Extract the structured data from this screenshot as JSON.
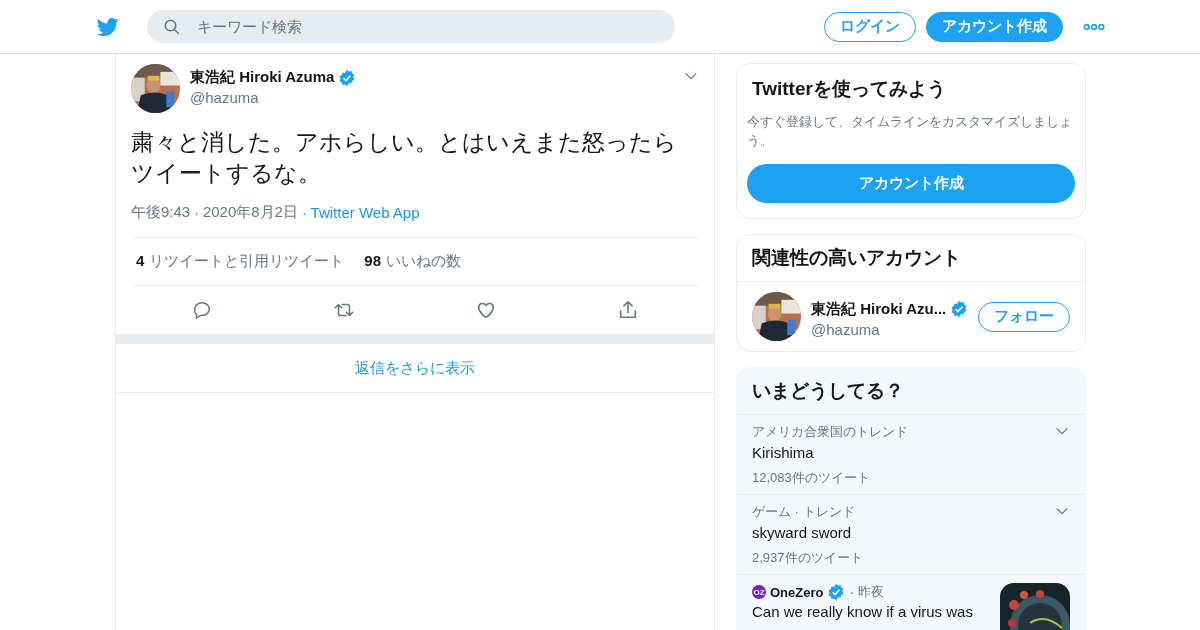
{
  "header": {
    "search": {
      "placeholder": "キーワード検索"
    },
    "login": "ログイン",
    "signup": "アカウント作成"
  },
  "tweet": {
    "name": "東浩紀 Hiroki Azuma",
    "verified": true,
    "handle": "@hazuma",
    "text": "粛々と消した。アホらしい。とはいえまた怒ったらツイートするな。",
    "meta": [
      {
        "kind": "time",
        "text": "午後9:43"
      },
      {
        "kind": "separator",
        "text": "·"
      },
      {
        "kind": "date",
        "text": "2020年8月2日"
      },
      {
        "kind": "separator",
        "text": "·"
      },
      {
        "kind": "source",
        "text": "Twitter Web App"
      }
    ],
    "stats": [
      {
        "count": "4",
        "label": "リツイートと引用リツイート"
      },
      {
        "count": "98",
        "label": "いいねの数"
      }
    ],
    "more_replies": "返信をさらに表示"
  },
  "signup_card": {
    "title": "Twitterを使ってみよう",
    "text": "今すぐ登録して、タイムラインをカスタマイズしましょう。",
    "button": "アカウント作成"
  },
  "related": {
    "title": "関連性の高いアカウント",
    "accounts": [
      {
        "name": "東浩紀 Hiroki Azu...",
        "verified": true,
        "handle": "@hazuma",
        "button": "フォロー"
      }
    ]
  },
  "trends": {
    "title": "いまどうしてる？",
    "items": [
      {
        "kind": "trend",
        "category": "アメリカ合衆国のトレンド",
        "name": "Kirishima",
        "count": "12,083件のツイート"
      },
      {
        "kind": "trend",
        "category": "ゲーム · トレンド",
        "name": "skyward sword",
        "count": "2,937件のツイート"
      },
      {
        "kind": "news",
        "logo": "OZ",
        "source": "OneZero",
        "verified": true,
        "separator": "·",
        "time": "昨夜",
        "headline": "Can we really know if a virus was"
      }
    ]
  }
}
